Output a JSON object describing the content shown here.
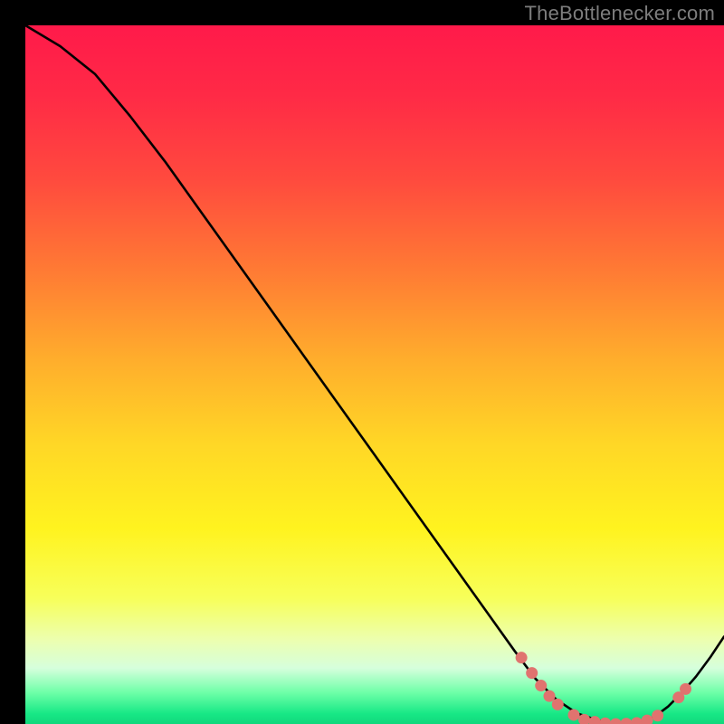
{
  "watermark": "TheBottlenecker.com",
  "gradient": {
    "stops": [
      {
        "offset": 0.0,
        "color": "#ff1a4a"
      },
      {
        "offset": 0.1,
        "color": "#ff2a46"
      },
      {
        "offset": 0.22,
        "color": "#ff4a3e"
      },
      {
        "offset": 0.35,
        "color": "#ff7a34"
      },
      {
        "offset": 0.48,
        "color": "#ffae2c"
      },
      {
        "offset": 0.6,
        "color": "#ffd726"
      },
      {
        "offset": 0.72,
        "color": "#fff31f"
      },
      {
        "offset": 0.82,
        "color": "#f7ff5a"
      },
      {
        "offset": 0.88,
        "color": "#ecffb0"
      },
      {
        "offset": 0.92,
        "color": "#d6ffdc"
      },
      {
        "offset": 0.955,
        "color": "#6effa8"
      },
      {
        "offset": 0.985,
        "color": "#18e886"
      },
      {
        "offset": 1.0,
        "color": "#10d87c"
      }
    ]
  },
  "chart_data": {
    "type": "line",
    "title": "",
    "xlabel": "",
    "ylabel": "",
    "xlim": [
      0,
      100
    ],
    "ylim": [
      0,
      100
    ],
    "series": [
      {
        "name": "curve",
        "x": [
          0,
          5,
          10,
          15,
          20,
          25,
          30,
          35,
          40,
          45,
          50,
          55,
          60,
          65,
          70,
          73,
          76,
          79,
          82,
          85,
          88,
          90,
          92,
          94,
          96,
          98,
          100
        ],
        "y": [
          100,
          97,
          93,
          87,
          80.5,
          73.5,
          66.5,
          59.5,
          52.5,
          45.5,
          38.5,
          31.5,
          24.5,
          17.5,
          10.5,
          6.5,
          3.5,
          1.5,
          0.5,
          0.0,
          0.2,
          1.0,
          2.5,
          4.5,
          6.8,
          9.5,
          12.5
        ]
      }
    ],
    "markers": {
      "name": "highlight-dots",
      "color": "#e0736f",
      "points": [
        {
          "x": 71.0,
          "y": 9.5
        },
        {
          "x": 72.5,
          "y": 7.3
        },
        {
          "x": 73.8,
          "y": 5.5
        },
        {
          "x": 75.0,
          "y": 4.0
        },
        {
          "x": 76.2,
          "y": 2.8
        },
        {
          "x": 78.5,
          "y": 1.3
        },
        {
          "x": 80.0,
          "y": 0.6
        },
        {
          "x": 81.5,
          "y": 0.3
        },
        {
          "x": 83.0,
          "y": 0.1
        },
        {
          "x": 84.5,
          "y": 0.0
        },
        {
          "x": 86.0,
          "y": 0.05
        },
        {
          "x": 87.5,
          "y": 0.15
        },
        {
          "x": 89.0,
          "y": 0.5
        },
        {
          "x": 90.5,
          "y": 1.2
        },
        {
          "x": 93.5,
          "y": 3.8
        },
        {
          "x": 94.5,
          "y": 5.0
        }
      ]
    }
  }
}
